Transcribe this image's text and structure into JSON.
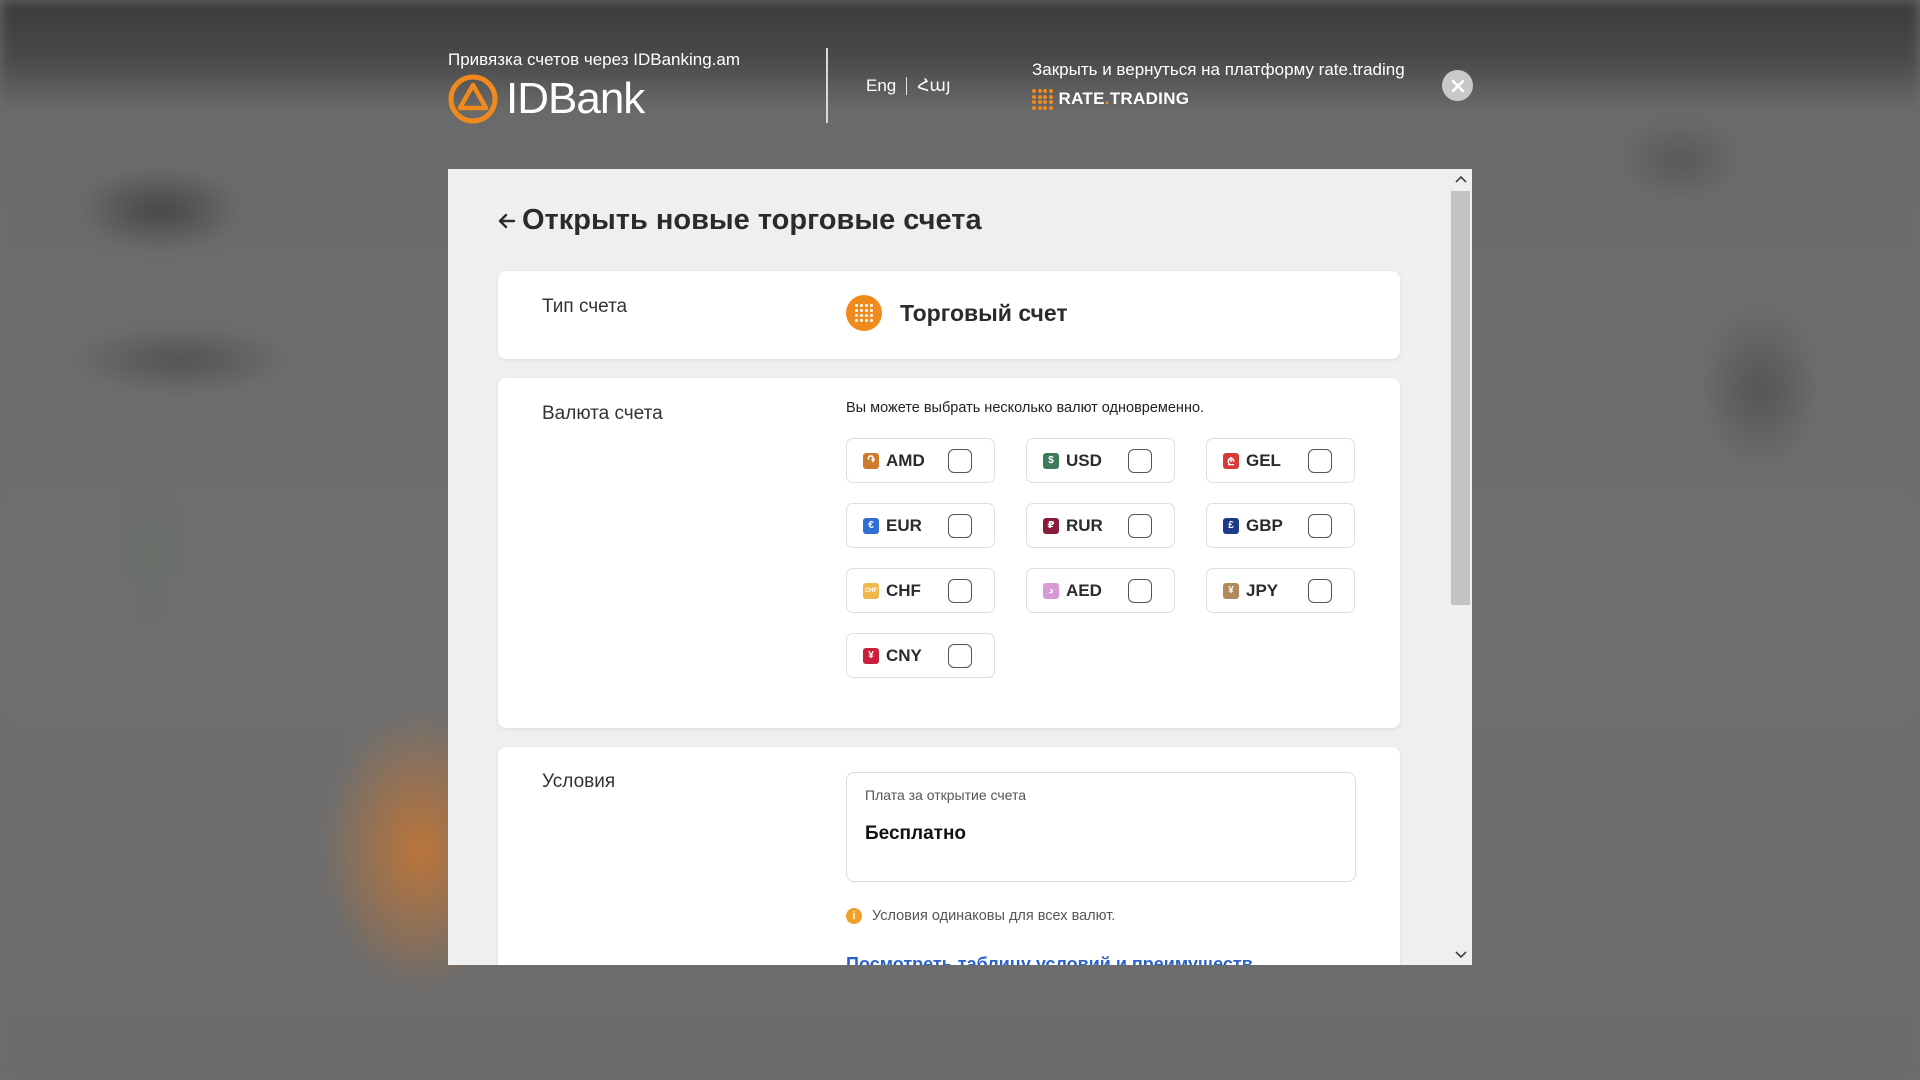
{
  "header": {
    "caption": "Привязка счетов через IDBanking.am",
    "logo_text": "IDBank",
    "lang_en": "Eng",
    "lang_hy": "Հայ",
    "close_text": "Закрыть и вернуться на платформу rate.trading",
    "partner_logo_main": "RATE",
    "partner_logo_dot": ".",
    "partner_logo_tail": "TRADING",
    "accent": "#f08a1c"
  },
  "page": {
    "title": "Открыть новые торговые счета",
    "back_icon": "arrow-left-icon"
  },
  "account_type": {
    "label": "Тип счета",
    "value": "Торговый счет"
  },
  "currency": {
    "label": "Валюта счета",
    "hint": "Вы можете выбрать несколько валют одновременно.",
    "items": [
      {
        "code": "AMD",
        "glyph": "֏",
        "color": "#d07a2e",
        "checked": false
      },
      {
        "code": "USD",
        "glyph": "$",
        "color": "#3d7a5a",
        "checked": false
      },
      {
        "code": "GEL",
        "glyph": "₾",
        "color": "#d63a3a",
        "checked": false
      },
      {
        "code": "EUR",
        "glyph": "€",
        "color": "#2e6fd1",
        "checked": false
      },
      {
        "code": "RUR",
        "glyph": "₽",
        "color": "#8a1c3a",
        "checked": false
      },
      {
        "code": "GBP",
        "glyph": "£",
        "color": "#1f3a8a",
        "checked": false
      },
      {
        "code": "CHF",
        "glyph": "CHF",
        "color": "#f0b84a",
        "checked": false
      },
      {
        "code": "AED",
        "glyph": "د",
        "color": "#d79ad6",
        "checked": false
      },
      {
        "code": "JPY",
        "glyph": "¥",
        "color": "#b08a5a",
        "checked": false
      },
      {
        "code": "CNY",
        "glyph": "¥",
        "color": "#c8203a",
        "checked": false
      }
    ]
  },
  "conditions": {
    "label": "Условия",
    "fee_label": "Плата за открытие счета",
    "fee_value": "Бесплатно",
    "info_text": "Условия одинаковы для всех валют.",
    "link_text": "Посмотреть таблицу условий и преимуществ"
  }
}
